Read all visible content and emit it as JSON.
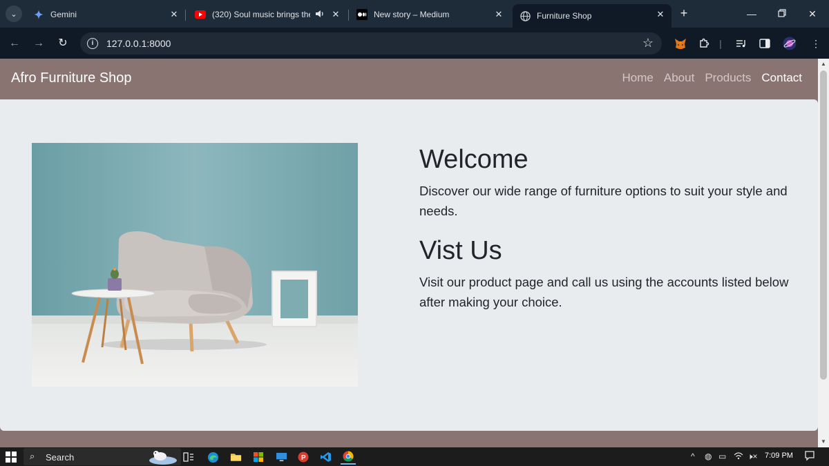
{
  "browser": {
    "tabs": [
      {
        "title": "Gemini",
        "close": "✕"
      },
      {
        "title": "(320) Soul music brings the",
        "close": "✕"
      },
      {
        "title": "New story – Medium",
        "close": "✕"
      },
      {
        "title": "Furniture Shop",
        "close": "✕"
      }
    ],
    "url": "127.0.0.1:8000"
  },
  "site": {
    "brand": "Afro Furniture Shop",
    "nav": [
      "Home",
      "About",
      "Products",
      "Contact"
    ],
    "active_nav": "Contact",
    "welcome_heading": "Welcome",
    "welcome_text": "Discover our wide range of furniture options to suit your style and needs.",
    "visit_heading": "Vist Us",
    "visit_text": "Visit our product page and call us using the accounts listed below after making your choice."
  },
  "taskbar": {
    "search_label": "Search",
    "clock": "7:09 PM"
  },
  "colors": {
    "navbar": "#8a7472",
    "content_bg": "#e9ecef",
    "browser_frame": "#1e2b38"
  }
}
